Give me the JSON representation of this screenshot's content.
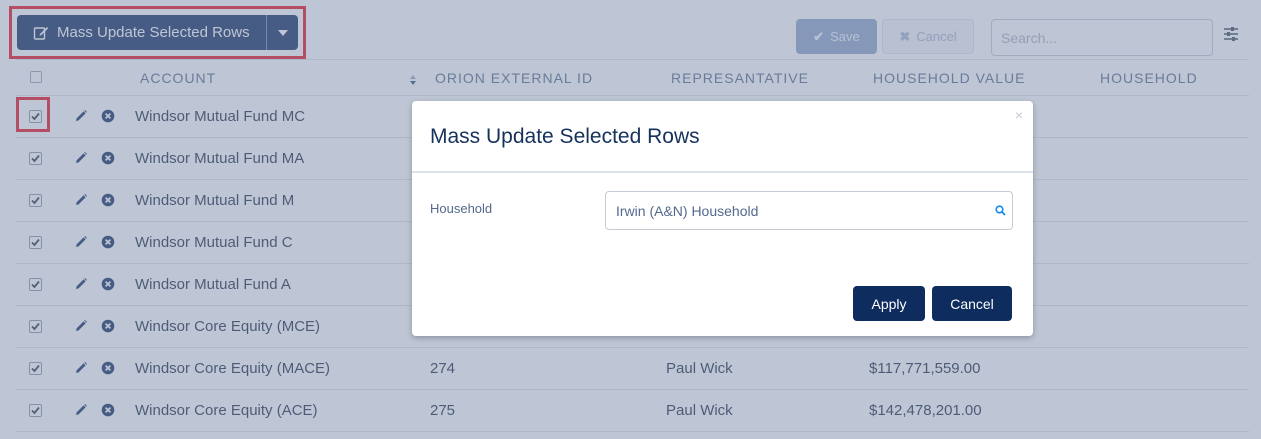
{
  "toolbar": {
    "mass_update_label": "Mass Update Selected Rows",
    "save_label": "Save",
    "cancel_label": "Cancel",
    "search_placeholder": "Search...",
    "save_icon": "check-icon",
    "cancel_icon": "x-icon",
    "filter_icon": "sliders-icon"
  },
  "table": {
    "columns": [
      "ACCOUNT",
      "ORION EXTERNAL ID",
      "REPRESANTATIVE",
      "HOUSEHOLD VALUE",
      "HOUSEHOLD"
    ],
    "rows": [
      {
        "account": "Windsor Mutual Fund MC",
        "external_id": "",
        "representative": "",
        "household_value": "",
        "checked": true
      },
      {
        "account": "Windsor Mutual Fund MA",
        "external_id": "",
        "representative": "",
        "household_value": "",
        "checked": true
      },
      {
        "account": "Windsor Mutual Fund M",
        "external_id": "",
        "representative": "",
        "household_value": "",
        "checked": true
      },
      {
        "account": "Windsor Mutual Fund C",
        "external_id": "",
        "representative": "",
        "household_value": "",
        "checked": true
      },
      {
        "account": "Windsor Mutual Fund A",
        "external_id": "",
        "representative": "",
        "household_value": "",
        "checked": true
      },
      {
        "account": "Windsor Core Equity (MCE)",
        "external_id": "",
        "representative": "",
        "household_value": "",
        "checked": true
      },
      {
        "account": "Windsor Core Equity (MACE)",
        "external_id": "274",
        "representative": "Paul Wick",
        "household_value": "$117,771,559.00",
        "checked": true
      },
      {
        "account": "Windsor Core Equity (ACE)",
        "external_id": "275",
        "representative": "Paul Wick",
        "household_value": "$142,478,201.00",
        "checked": true
      }
    ]
  },
  "modal": {
    "title": "Mass Update Selected Rows",
    "close_glyph": "×",
    "field_label": "Household",
    "field_value": "Irwin (A&N) Household",
    "apply_label": "Apply",
    "cancel_label": "Cancel"
  },
  "colors": {
    "primary": "#0e2c5e",
    "highlight": "#e8101e",
    "overlay": "#7e8caa"
  }
}
